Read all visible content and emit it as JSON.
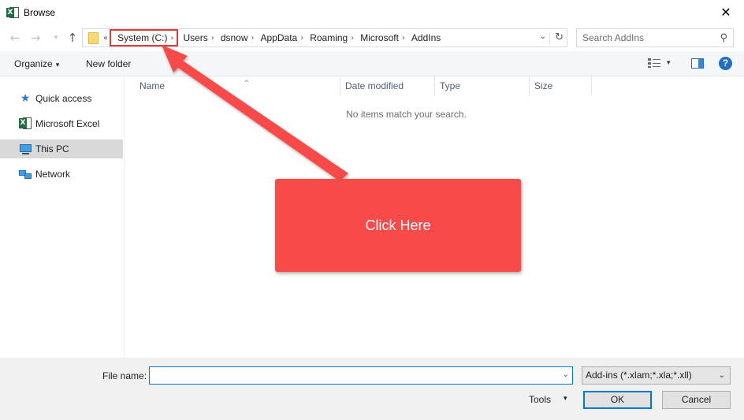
{
  "window": {
    "title": "Browse",
    "close_glyph": "✕"
  },
  "nav": {
    "back_glyph": "←",
    "forward_glyph": "→",
    "recent_glyph": "▾",
    "up_glyph": "↑"
  },
  "address": {
    "more_glyph": "«",
    "crumbs": [
      {
        "label": "System (C:)"
      },
      {
        "label": "Users"
      },
      {
        "label": "dsnow"
      },
      {
        "label": "AppData"
      },
      {
        "label": "Roaming"
      },
      {
        "label": "Microsoft"
      },
      {
        "label": "AddIns"
      }
    ],
    "separator": "›",
    "dropdown_glyph": "⌄",
    "refresh_glyph": "↻"
  },
  "search": {
    "placeholder": "Search AddIns",
    "icon_glyph": "⚲"
  },
  "toolbar": {
    "organize_label": "Organize",
    "organize_caret": "▾",
    "new_folder_label": "New folder",
    "view_caret": "▾",
    "help_glyph": "?"
  },
  "sidebar": {
    "items": [
      {
        "label": "Quick access",
        "icon": "star-icon",
        "glyph": "★"
      },
      {
        "label": "Microsoft Excel",
        "icon": "excel-icon",
        "glyph": "X"
      },
      {
        "label": "This PC",
        "icon": "computer-icon",
        "selected": true
      },
      {
        "label": "Network",
        "icon": "network-icon"
      }
    ]
  },
  "columns": {
    "name": "Name",
    "date_modified": "Date modified",
    "type": "Type",
    "size": "Size",
    "sort_glyph": "^"
  },
  "content": {
    "empty_message": "No items match your search."
  },
  "footer": {
    "file_name_label": "File name:",
    "file_name_value": "",
    "file_name_caret": "⌄",
    "filter_value": "Add-ins (*.xlam;*.xla;*.xll)",
    "filter_caret": "⌄",
    "tools_label": "Tools",
    "tools_caret": "▾",
    "ok_label": "OK",
    "cancel_label": "Cancel"
  },
  "annotation": {
    "callout_text": "Click Here",
    "color": "#f94a4a"
  },
  "colors": {
    "accent": "#0078d7",
    "excel_green": "#1d6f42",
    "highlight_red": "#e03b3b"
  }
}
